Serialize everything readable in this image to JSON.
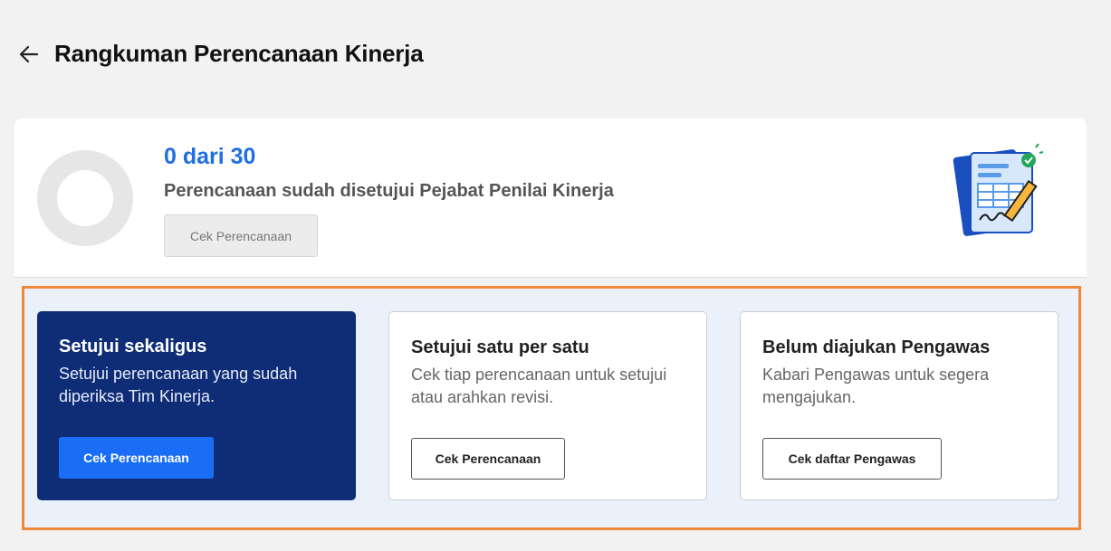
{
  "header": {
    "title": "Rangkuman Perencanaan Kinerja",
    "back_icon": "arrow-left-icon"
  },
  "summary": {
    "count_text": "0 dari 30",
    "approved": 0,
    "total": 30,
    "description": "Perencanaan sudah disetujui Pejabat Penilai Kinerja",
    "button_label": "Cek Perencanaan",
    "illustration_icon": "document-checklist-icon"
  },
  "options": [
    {
      "title": "Setujui sekaligus",
      "description": "Setujui perencanaan yang sudah diperiksa Tim Kinerja.",
      "button_label": "Cek Perencanaan"
    },
    {
      "title": "Setujui satu per satu",
      "description": "Cek tiap perencanaan untuk setujui atau arahkan revisi.",
      "button_label": "Cek Perencanaan"
    },
    {
      "title": "Belum diajukan Pengawas",
      "description": "Kabari Pengawas untuk segera mengajukan.",
      "button_label": "Cek daftar Pengawas"
    }
  ],
  "colors": {
    "accent_blue": "#1f6fe0",
    "primary_card": "#0f2d77",
    "highlight_border": "#f0883a",
    "panel_bg": "#eaf1fb"
  }
}
